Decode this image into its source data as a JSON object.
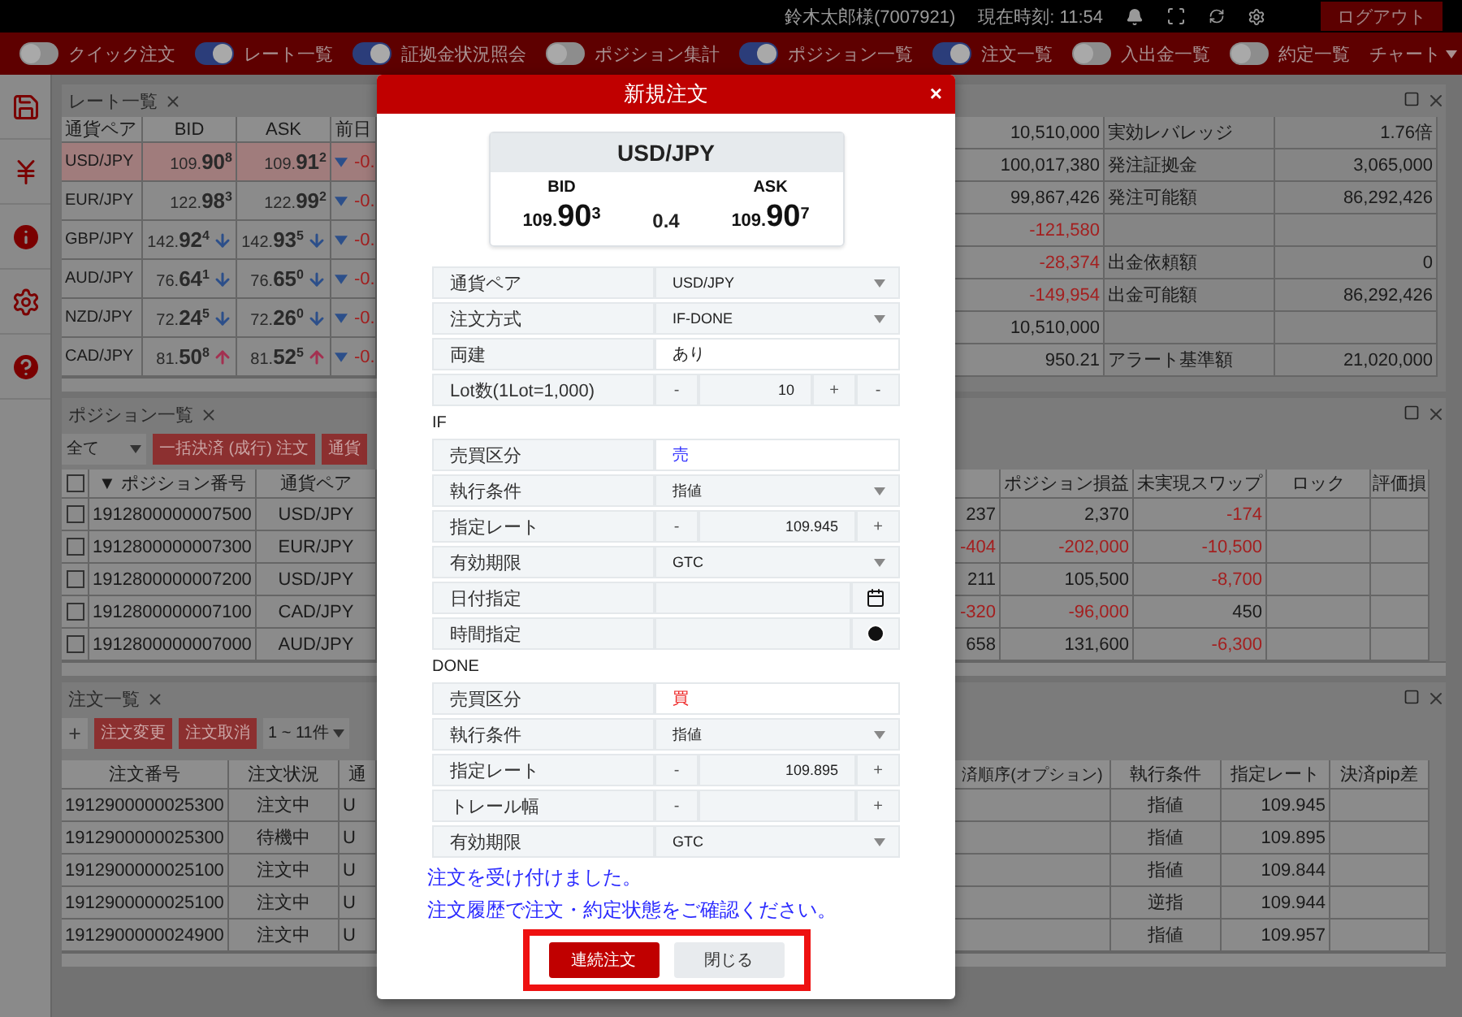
{
  "header": {
    "user": "鈴木太郎様(7007921)",
    "clock": "現在時刻: 11:54",
    "logout": "ログアウト"
  },
  "toolbar": {
    "toggles": [
      {
        "label": "クイック注文",
        "on": false
      },
      {
        "label": "レート一覧",
        "on": true
      },
      {
        "label": "証拠金状況照会",
        "on": true
      },
      {
        "label": "ポジション集計",
        "on": false
      },
      {
        "label": "ポジション一覧",
        "on": true
      },
      {
        "label": "注文一覧",
        "on": true
      },
      {
        "label": "入出金一覧",
        "on": false
      },
      {
        "label": "約定一覧",
        "on": false
      }
    ],
    "menu": "チャート"
  },
  "rate_panel": {
    "tab": "レート一覧",
    "columns": [
      "通貨ペア",
      "BID",
      "ASK",
      "前日"
    ],
    "rows": [
      {
        "pair": "USD/JPY",
        "selected": true,
        "bid": {
          "base": "109.",
          "big": "90",
          "pip": "8"
        },
        "ask": {
          "base": "109.",
          "big": "91",
          "pip": "2"
        },
        "change": "-0."
      },
      {
        "pair": "EUR/JPY",
        "selected": false,
        "bid": {
          "base": "122.",
          "big": "98",
          "pip": "3"
        },
        "ask": {
          "base": "122.",
          "big": "99",
          "pip": "2"
        },
        "change": "-0."
      },
      {
        "pair": "GBP/JPY",
        "selected": false,
        "bid": {
          "base": "142.",
          "big": "92",
          "pip": "4"
        },
        "ask": {
          "base": "142.",
          "big": "93",
          "pip": "5"
        },
        "falling": true,
        "change": "-0."
      },
      {
        "pair": "AUD/JPY",
        "selected": false,
        "bid": {
          "base": "76.",
          "big": "64",
          "pip": "1"
        },
        "ask": {
          "base": "76.",
          "big": "65",
          "pip": "0"
        },
        "falling": true,
        "change": "-0."
      },
      {
        "pair": "NZD/JPY",
        "selected": false,
        "bid": {
          "base": "72.",
          "big": "24",
          "pip": "5"
        },
        "ask": {
          "base": "72.",
          "big": "26",
          "pip": "0"
        },
        "falling": true,
        "change": "-0."
      },
      {
        "pair": "CAD/JPY",
        "selected": false,
        "bid": {
          "base": "81.",
          "big": "50",
          "pip": "8"
        },
        "ask": {
          "base": "81.",
          "big": "52",
          "pip": "5"
        },
        "rising": true,
        "change": "-0."
      }
    ]
  },
  "account_summary": {
    "rows": [
      {
        "amount": {
          "text": "10,510,000",
          "negative": false
        },
        "label": "実効レバレッジ",
        "value": "1.76倍"
      },
      {
        "amount": {
          "text": "100,017,380",
          "negative": false
        },
        "label": "発注証拠金",
        "value": "3,065,000"
      },
      {
        "amount": {
          "text": "99,867,426",
          "negative": false
        },
        "label": "発注可能額",
        "value": "86,292,426"
      },
      {
        "amount": {
          "text": "-121,580",
          "negative": true
        }
      },
      {
        "amount": {
          "text": "-28,374",
          "negative": true
        },
        "label": "出金依頼額",
        "value": "0"
      },
      {
        "amount": {
          "text": "-149,954",
          "negative": true
        },
        "label": "出金可能額",
        "value": "86,292,426"
      },
      {
        "amount": {
          "text": "10,510,000",
          "negative": false
        }
      },
      {
        "amount": {
          "text": "950.21",
          "negative": false
        },
        "label": "アラート基準額",
        "value": "21,020,000"
      }
    ]
  },
  "position_panel": {
    "tab": "ポジション一覧",
    "filter": "全て",
    "select_all_checked": false,
    "buttons": [
      "一括決済 (成行) 注文",
      "通貨"
    ],
    "columns": [
      "▼ ポジション番号",
      "通貨ペア"
    ],
    "columns_right": [
      "ポジション損益",
      "未実現スワップ",
      "ロック",
      "評価損"
    ],
    "rows": [
      {
        "checked": false,
        "id": "1912800000007500",
        "pair": "USD/JPY",
        "values": [
          {
            "text": "237",
            "negative": false
          },
          {
            "text": "2,370",
            "negative": false
          },
          {
            "text": "-174",
            "negative": true
          }
        ]
      },
      {
        "checked": false,
        "id": "1912800000007300",
        "pair": "EUR/JPY",
        "values": [
          {
            "text": "-404",
            "negative": true
          },
          {
            "text": "-202,000",
            "negative": true
          },
          {
            "text": "-10,500",
            "negative": true
          }
        ]
      },
      {
        "checked": false,
        "id": "1912800000007200",
        "pair": "USD/JPY",
        "values": [
          {
            "text": "211",
            "negative": false
          },
          {
            "text": "105,500",
            "negative": false
          },
          {
            "text": "-8,700",
            "negative": true
          }
        ]
      },
      {
        "checked": false,
        "id": "1912800000007100",
        "pair": "CAD/JPY",
        "values": [
          {
            "text": "-320",
            "negative": true
          },
          {
            "text": "-96,000",
            "negative": true
          },
          {
            "text": "450",
            "negative": false
          }
        ]
      },
      {
        "checked": false,
        "id": "1912800000007000",
        "pair": "AUD/JPY",
        "values": [
          {
            "text": "658",
            "negative": false
          },
          {
            "text": "131,600",
            "negative": false
          },
          {
            "text": "-6,300",
            "negative": true
          }
        ]
      }
    ]
  },
  "order_panel": {
    "tab": "注文一覧",
    "add": "+",
    "buttons": [
      "注文変更",
      "注文取消"
    ],
    "range": "1 ~ 11件",
    "columns": [
      "注文番号",
      "注文状況",
      "通"
    ],
    "columns_right": [
      "済順序(オプション)",
      "執行条件",
      "指定レート",
      "決済pip差"
    ],
    "rows": [
      {
        "id": "1912900000025300",
        "status": "注文中",
        "pair": "U",
        "condition": "指値",
        "rate": "109.945"
      },
      {
        "id": "1912900000025300",
        "status": "待機中",
        "pair": "U",
        "condition": "指値",
        "rate": "109.895"
      },
      {
        "id": "1912900000025100",
        "status": "注文中",
        "pair": "U",
        "condition": "指値",
        "rate": "109.844"
      },
      {
        "id": "1912900000025100",
        "status": "注文中",
        "pair": "U",
        "condition": "逆指",
        "rate": "109.944"
      },
      {
        "id": "1912900000024900",
        "status": "注文中",
        "pair": "U",
        "condition": "指値",
        "rate": "109.957"
      }
    ]
  },
  "order_dialog": {
    "title": "新規注文",
    "close": "×",
    "quote": {
      "pair": "USD/JPY",
      "bid_label": "BID",
      "ask_label": "ASK",
      "bid": {
        "base": "109.",
        "big": "90",
        "pip": "3"
      },
      "spread": "0.4",
      "ask": {
        "base": "109.",
        "big": "90",
        "pip": "7"
      }
    },
    "rows": [
      {
        "kind": "select",
        "label": "通貨ペア",
        "value": "USD/JPY"
      },
      {
        "kind": "select",
        "label": "注文方式",
        "value": "IF-DONE"
      },
      {
        "kind": "text",
        "label": "両建",
        "value": "あり"
      },
      {
        "kind": "stepper",
        "label": "Lot数(1Lot=1,000)",
        "before": [
          "-"
        ],
        "value": "10",
        "after": [
          "+",
          "-"
        ]
      }
    ],
    "sections": [
      {
        "heading": "IF",
        "rows": [
          {
            "kind": "text",
            "label": "売買区分",
            "value": "売",
            "color": "#3333ff"
          },
          {
            "kind": "select",
            "label": "執行条件",
            "value": "指値"
          },
          {
            "kind": "stepper",
            "label": "指定レート",
            "before": [
              "-"
            ],
            "value": "109.945",
            "after": [
              "+"
            ]
          },
          {
            "kind": "select",
            "label": "有効期限",
            "value": "GTC"
          },
          {
            "kind": "date",
            "label": "日付指定"
          },
          {
            "kind": "time",
            "label": "時間指定"
          }
        ]
      },
      {
        "heading": "DONE",
        "rows": [
          {
            "kind": "text",
            "label": "売買区分",
            "value": "買",
            "color": "#ee2222"
          },
          {
            "kind": "select",
            "label": "執行条件",
            "value": "指値"
          },
          {
            "kind": "stepper",
            "label": "指定レート",
            "before": [
              "-"
            ],
            "value": "109.895",
            "after": [
              "+"
            ]
          },
          {
            "kind": "stepper",
            "label": "トレール幅",
            "before": [
              "-"
            ],
            "after": [
              "+"
            ]
          },
          {
            "kind": "select",
            "label": "有効期限",
            "value": "GTC"
          }
        ]
      }
    ],
    "messages": [
      "注文を受け付けました。",
      "注文履歴で注文・約定状態をご確認ください。"
    ],
    "actions": {
      "highlighted": true,
      "buttons": [
        {
          "label": "連続注文",
          "primary": true
        },
        {
          "label": "閉じる",
          "primary": false
        }
      ]
    }
  }
}
